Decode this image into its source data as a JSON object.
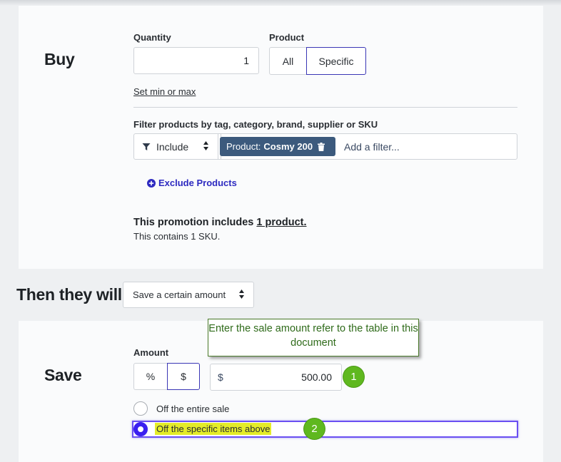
{
  "buy": {
    "title": "Buy",
    "quantity_label": "Quantity",
    "quantity_value": "1",
    "product_label": "Product",
    "product_options": [
      "All",
      "Specific"
    ],
    "product_selected": "Specific",
    "set_min_max": "Set min or max",
    "filter_label": "Filter products by tag, category, brand, supplier or SKU",
    "filter_mode": "Include",
    "chip_prefix": "Product:",
    "chip_value": "Cosmy 200",
    "add_filter": "Add a filter...",
    "exclude_products": "Exclude Products",
    "summary_prefix": "This promotion includes ",
    "summary_link": "1 product.",
    "summary_sub": "This contains 1 SKU."
  },
  "then": {
    "title": "Then they will",
    "action_value": "Save a certain amount"
  },
  "save": {
    "title": "Save",
    "amount_label": "Amount",
    "amount_options": [
      "%",
      "$"
    ],
    "amount_selected": "$",
    "currency_symbol": "$",
    "amount_value": "500.00",
    "option_entire": "Off the entire sale",
    "option_specific": "Off the specific items above",
    "selected_option": "Off the specific items above"
  },
  "annotations": {
    "callout_text": "Enter the sale amount refer to the table in this document",
    "badge_1": "1",
    "badge_2": "2",
    "callout_color": "#4a7a2a",
    "badge_color": "#5fb81f",
    "highlight_color": "#e4ec28"
  },
  "colors": {
    "accent": "#3a36b5",
    "radio_selected": "#3a1ff0",
    "chip_bg": "#3c5a7d"
  },
  "icons": [
    "filter-icon",
    "updown-icon",
    "trash-icon",
    "plus-circle-icon"
  ]
}
